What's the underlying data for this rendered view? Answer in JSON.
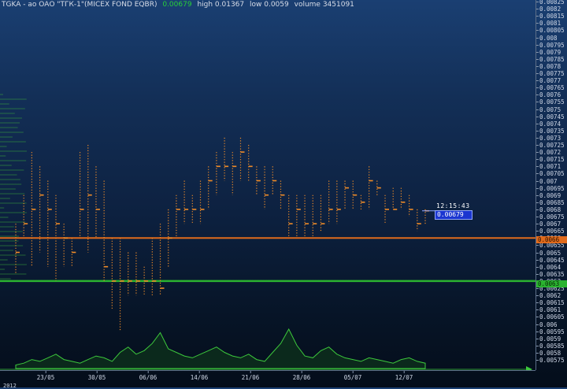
{
  "header": {
    "symbol": "TGKA - ао ОАО \"ТГК-1\"(MICEX FOND EQBR)",
    "last": "0.00679",
    "high_label": "high 0.01367",
    "low_label": "low 0.0059",
    "volume_label": "volume 3451091"
  },
  "colors": {
    "background_top": "#1a3f72",
    "background_bottom": "#040d1a",
    "bars": "#f08c28",
    "volume_line": "#3cc83c",
    "orange_level": "#e06a1c",
    "green_level": "#2bb330",
    "current_price_bg": "#1b36d0"
  },
  "price_axis": {
    "ticks": [
      "0.00825",
      "0.0082",
      "0.00815",
      "0.0081",
      "0.00805",
      "0.008",
      "0.00795",
      "0.0079",
      "0.00785",
      "0.0078",
      "0.00775",
      "0.0077",
      "0.00765",
      "0.0076",
      "0.00755",
      "0.0075",
      "0.00745",
      "0.0074",
      "0.00735",
      "0.0073",
      "0.00725",
      "0.0072",
      "0.00715",
      "0.0071",
      "0.00705",
      "0.007",
      "0.00695",
      "0.0069",
      "0.00685",
      "0.0068",
      "0.00675",
      "0.0067",
      "0.00665",
      "0.0066",
      "0.00655",
      "0.0065",
      "0.00645",
      "0.0064",
      "0.00635",
      "0.0063",
      "0.00625",
      "0.0062",
      "0.00615",
      "0.0061",
      "0.00605",
      "0.006",
      "0.00595",
      "0.0059",
      "0.00585",
      "0.0058",
      "0.00575"
    ],
    "orange_level_label": "0.0066",
    "green_level_label": "0.0063"
  },
  "time_axis": {
    "ticks": [
      "23/05",
      "30/05",
      "06/06",
      "14/06",
      "21/06",
      "28/06",
      "05/07",
      "12/07"
    ],
    "year": "2012"
  },
  "current": {
    "time": "12:15:43",
    "price": "0.00679"
  },
  "chart_data": {
    "type": "bar",
    "title": "TGKA - ао ОАО \"ТГК-1\"(MICEX FOND EQBR)",
    "xlabel": "",
    "ylabel": "",
    "ylim": [
      0.00575,
      0.00825
    ],
    "levels": [
      0.0066,
      0.0063
    ],
    "bars": [
      {
        "high": 0.0067,
        "low": 0.00635,
        "close": 0.0065
      },
      {
        "high": 0.0069,
        "low": 0.0066,
        "close": 0.0067
      },
      {
        "high": 0.0072,
        "low": 0.0064,
        "close": 0.0068
      },
      {
        "high": 0.0071,
        "low": 0.0065,
        "close": 0.0069
      },
      {
        "high": 0.007,
        "low": 0.0064,
        "close": 0.0068
      },
      {
        "high": 0.0069,
        "low": 0.0063,
        "close": 0.0067
      },
      {
        "high": 0.0067,
        "low": 0.0064,
        "close": 0.0066
      },
      {
        "high": 0.0066,
        "low": 0.0064,
        "close": 0.0065
      },
      {
        "high": 0.0072,
        "low": 0.0066,
        "close": 0.0068
      },
      {
        "high": 0.00725,
        "low": 0.0065,
        "close": 0.0069
      },
      {
        "high": 0.0071,
        "low": 0.0066,
        "close": 0.0068
      },
      {
        "high": 0.007,
        "low": 0.0063,
        "close": 0.0064
      },
      {
        "high": 0.0066,
        "low": 0.0061,
        "close": 0.0063
      },
      {
        "high": 0.0066,
        "low": 0.00595,
        "close": 0.0063
      },
      {
        "high": 0.0065,
        "low": 0.0062,
        "close": 0.0063
      },
      {
        "high": 0.0065,
        "low": 0.0062,
        "close": 0.0063
      },
      {
        "high": 0.0064,
        "low": 0.0062,
        "close": 0.0063
      },
      {
        "high": 0.0066,
        "low": 0.0062,
        "close": 0.0063
      },
      {
        "high": 0.0067,
        "low": 0.0062,
        "close": 0.00625
      },
      {
        "high": 0.0068,
        "low": 0.0064,
        "close": 0.0066
      },
      {
        "high": 0.0069,
        "low": 0.0066,
        "close": 0.0068
      },
      {
        "high": 0.007,
        "low": 0.0067,
        "close": 0.0068
      },
      {
        "high": 0.0069,
        "low": 0.0067,
        "close": 0.0068
      },
      {
        "high": 0.007,
        "low": 0.0067,
        "close": 0.0068
      },
      {
        "high": 0.0071,
        "low": 0.0068,
        "close": 0.007
      },
      {
        "high": 0.0072,
        "low": 0.0069,
        "close": 0.0071
      },
      {
        "high": 0.0073,
        "low": 0.007,
        "close": 0.0071
      },
      {
        "high": 0.0072,
        "low": 0.0069,
        "close": 0.0071
      },
      {
        "high": 0.0073,
        "low": 0.007,
        "close": 0.0072
      },
      {
        "high": 0.00725,
        "low": 0.007,
        "close": 0.0071
      },
      {
        "high": 0.0071,
        "low": 0.0069,
        "close": 0.007
      },
      {
        "high": 0.0071,
        "low": 0.0068,
        "close": 0.0069
      },
      {
        "high": 0.0071,
        "low": 0.0069,
        "close": 0.007
      },
      {
        "high": 0.007,
        "low": 0.0068,
        "close": 0.0069
      },
      {
        "high": 0.0069,
        "low": 0.0066,
        "close": 0.0067
      },
      {
        "high": 0.0069,
        "low": 0.0066,
        "close": 0.0068
      },
      {
        "high": 0.0069,
        "low": 0.0066,
        "close": 0.0067
      },
      {
        "high": 0.0069,
        "low": 0.0066,
        "close": 0.0067
      },
      {
        "high": 0.0069,
        "low": 0.00665,
        "close": 0.0067
      },
      {
        "high": 0.007,
        "low": 0.0067,
        "close": 0.0068
      },
      {
        "high": 0.007,
        "low": 0.0067,
        "close": 0.0068
      },
      {
        "high": 0.007,
        "low": 0.0068,
        "close": 0.00695
      },
      {
        "high": 0.007,
        "low": 0.0068,
        "close": 0.0069
      },
      {
        "high": 0.0069,
        "low": 0.0068,
        "close": 0.00685
      },
      {
        "high": 0.0071,
        "low": 0.0068,
        "close": 0.007
      },
      {
        "high": 0.007,
        "low": 0.0069,
        "close": 0.00695
      },
      {
        "high": 0.0069,
        "low": 0.0067,
        "close": 0.0068
      },
      {
        "high": 0.00695,
        "low": 0.0068,
        "close": 0.0068
      },
      {
        "high": 0.00695,
        "low": 0.0068,
        "close": 0.00685
      },
      {
        "high": 0.0069,
        "low": 0.00675,
        "close": 0.0068
      },
      {
        "high": 0.0068,
        "low": 0.00665,
        "close": 0.0067
      },
      {
        "high": 0.0068,
        "low": 0.0067,
        "close": 0.00679
      }
    ],
    "volume": [
      2,
      3,
      5,
      4,
      6,
      8,
      5,
      4,
      3,
      5,
      7,
      6,
      4,
      9,
      12,
      8,
      10,
      14,
      20,
      11,
      9,
      7,
      6,
      8,
      10,
      12,
      9,
      7,
      6,
      8,
      5,
      4,
      9,
      14,
      22,
      13,
      7,
      6,
      10,
      12,
      8,
      6,
      5,
      4,
      6,
      5,
      4,
      3,
      5,
      6,
      4,
      3
    ]
  }
}
